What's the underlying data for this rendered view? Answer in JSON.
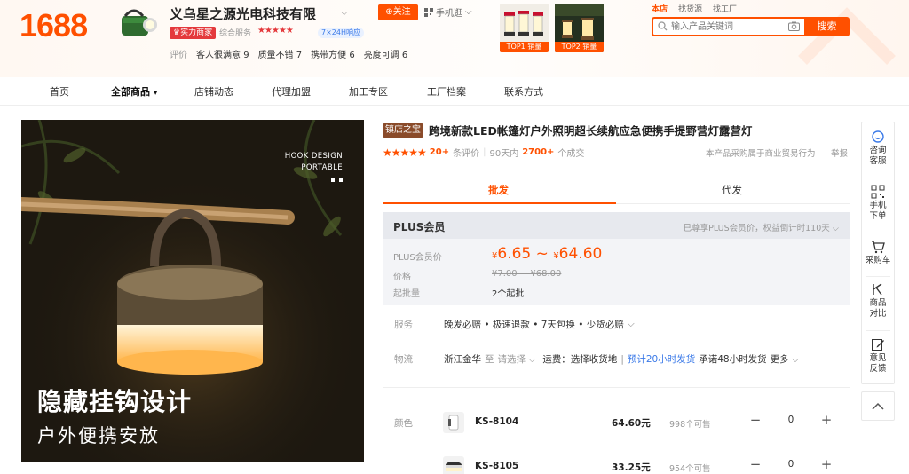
{
  "header": {
    "logo": "1688",
    "store_name": "义乌星之源光电科技有限",
    "follow_label": "关注",
    "mobile_label": "手机逛",
    "badge_strength": "实力商家",
    "service_label": "综合服务",
    "service_stars": "★★★★★",
    "badge_service": "7×24H响应",
    "rating_label": "评价",
    "ratings": [
      {
        "label": "客人很满意",
        "value": "9"
      },
      {
        "label": "质量不错",
        "value": "7"
      },
      {
        "label": "携带方便",
        "value": "6"
      },
      {
        "label": "亮度可调",
        "value": "6"
      }
    ],
    "thumb_tags": [
      "TOP1 销量",
      "TOP2 销量"
    ],
    "search_scopes": [
      "本店",
      "找货源",
      "找工厂"
    ],
    "search_placeholder": "输入产品关键词",
    "search_button": "搜索"
  },
  "nav": {
    "items": [
      "首页",
      "全部商品",
      "店铺动态",
      "代理加盟",
      "加工专区",
      "工厂档案",
      "联系方式"
    ]
  },
  "gallery": {
    "hook_line1": "HOOK DESIGN",
    "hook_line2": "PORTABLE",
    "caption_line1": "隐藏挂钩设计",
    "caption_line2": "户外便携安放"
  },
  "product": {
    "badge": "镇店之宝",
    "title": "跨境新款LED帐篷灯户外照明超长续航应急便携手提野营灯露营灯",
    "stars": "★★★★★",
    "review_count": "20+",
    "review_label": "条评价",
    "period_label": "90天内",
    "sold_count": "2700+",
    "sold_label": "个成交",
    "procurement": "本产品采购属于商业贸易行为",
    "report": "举报"
  },
  "tabs": {
    "wholesale": "批发",
    "dropship": "代发"
  },
  "plus": {
    "title": "PLUS会员",
    "note": "已尊享PLUS会员价，权益倒计时110天",
    "member_price_label": "PLUS会员价",
    "currency": "¥",
    "price_low": "6.65",
    "price_tilde": "~",
    "price_high": "64.60",
    "orig_label": "价格",
    "orig_price": "¥7.00 ~ ¥68.00",
    "moq_label": "起批量",
    "moq_value": "2个起批"
  },
  "service": {
    "label": "服务",
    "value": "晚发必赔 • 极速退款 • 7天包换 • 少货必赔"
  },
  "logistics": {
    "label": "物流",
    "origin": "浙江金华",
    "to": "至",
    "select": "请选择",
    "freight": "运费：选择收货地",
    "ship_time": "预计20小时发货",
    "promise": "承诺48小时发货",
    "more": "更多"
  },
  "variants": {
    "color_label": "颜色",
    "items": [
      {
        "name": "KS-8104",
        "price": "64.60元",
        "stock": "998个可售",
        "qty": "0"
      },
      {
        "name": "KS-8105",
        "price": "33.25元",
        "stock": "954个可售",
        "qty": "0"
      }
    ]
  },
  "sidebar": {
    "items": [
      {
        "line1": "咨询",
        "line2": "客服"
      },
      {
        "line1": "手机",
        "line2": "下单"
      },
      {
        "line1": "采购车",
        "line2": ""
      },
      {
        "line1": "商品",
        "line2": "对比"
      },
      {
        "line1": "意见",
        "line2": "反馈"
      }
    ]
  },
  "colors": {
    "brand": "#ff5000",
    "accent_red": "#e4393c",
    "link_blue": "#3b7ae8"
  }
}
